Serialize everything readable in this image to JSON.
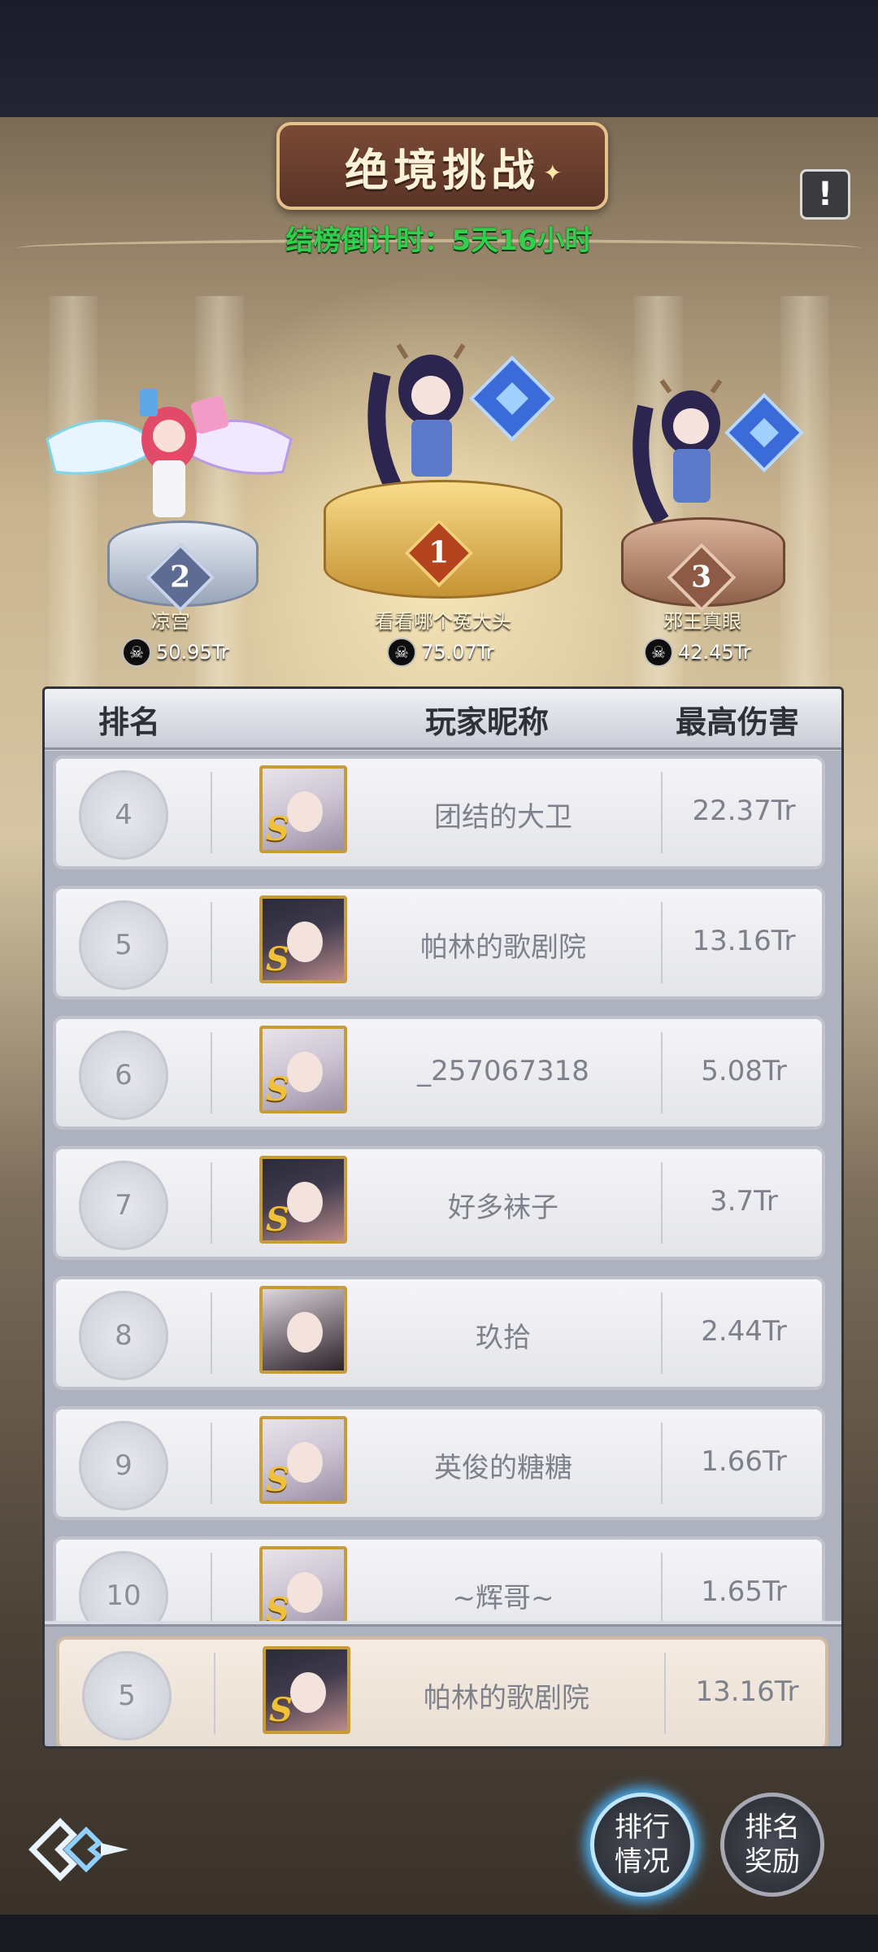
{
  "header": {
    "title": "绝境挑战",
    "countdown": "结榜倒计时：5天16小时",
    "info_icon": "exclamation-icon"
  },
  "podium": {
    "first": {
      "rank": "1",
      "name": "看看哪个菟大头",
      "score": "75.07Tr"
    },
    "second": {
      "rank": "2",
      "name": "凉宫",
      "score": "50.95Tr"
    },
    "third": {
      "rank": "3",
      "name": "邪王真眼",
      "score": "42.45Tr"
    }
  },
  "table": {
    "headers": {
      "rank": "排名",
      "player": "玩家昵称",
      "damage": "最高伤害"
    },
    "rows": [
      {
        "rank": "4",
        "name": "团结的大卫",
        "damage": "22.37Tr"
      },
      {
        "rank": "5",
        "name": "帕林的歌剧院",
        "damage": "13.16Tr"
      },
      {
        "rank": "6",
        "name": "_257067318",
        "damage": "5.08Tr"
      },
      {
        "rank": "7",
        "name": "好多袜子",
        "damage": "3.7Tr"
      },
      {
        "rank": "8",
        "name": "玖拾",
        "damage": "2.44Tr"
      },
      {
        "rank": "9",
        "name": "英俊的糖糖",
        "damage": "1.66Tr"
      },
      {
        "rank": "10",
        "name": "~辉哥~",
        "damage": "1.65Tr"
      }
    ],
    "my_row": {
      "rank": "5",
      "name": "帕林的歌剧院",
      "damage": "13.16Tr"
    }
  },
  "footer": {
    "ranking_status_label": "排行\n情况",
    "ranking_rewards_label": "排名\n奖励"
  },
  "colors": {
    "countdown_green": "#31d04c",
    "gold_frame": "#c79a3a",
    "active_glow": "#49b4ff"
  }
}
